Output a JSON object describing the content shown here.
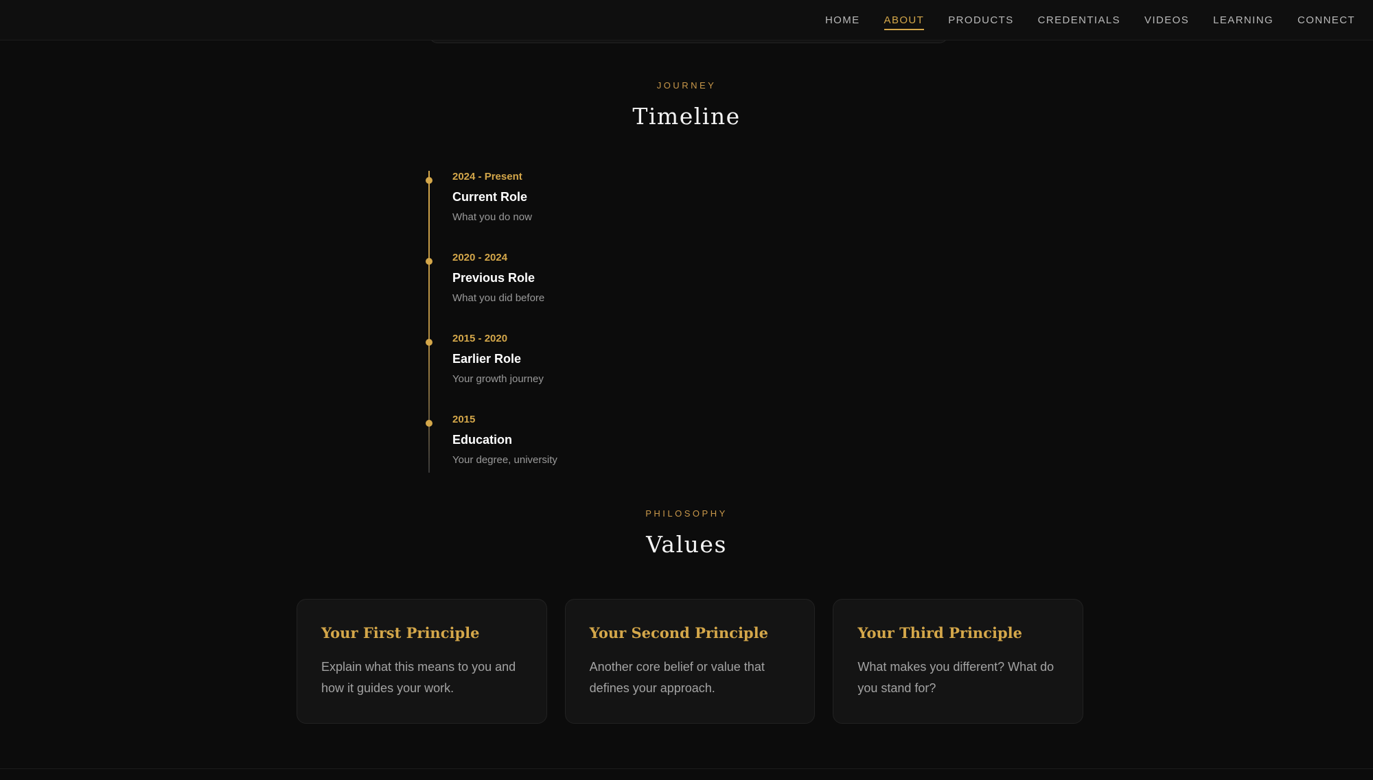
{
  "nav": {
    "items": [
      {
        "label": "HOME",
        "active": false
      },
      {
        "label": "ABOUT",
        "active": true
      },
      {
        "label": "PRODUCTS",
        "active": false
      },
      {
        "label": "CREDENTIALS",
        "active": false
      },
      {
        "label": "VIDEOS",
        "active": false
      },
      {
        "label": "LEARNING",
        "active": false
      },
      {
        "label": "CONNECT",
        "active": false
      }
    ]
  },
  "timeline_section": {
    "eyebrow": "JOURNEY",
    "title": "Timeline",
    "items": [
      {
        "date": "2024 - Present",
        "role": "Current Role",
        "description": "What you do now"
      },
      {
        "date": "2020 - 2024",
        "role": "Previous Role",
        "description": "What you did before"
      },
      {
        "date": "2015 - 2020",
        "role": "Earlier Role",
        "description": "Your growth journey"
      },
      {
        "date": "2015",
        "role": "Education",
        "description": "Your degree, university"
      }
    ]
  },
  "values_section": {
    "eyebrow": "PHILOSOPHY",
    "title": "Values",
    "cards": [
      {
        "title": "Your First Principle",
        "text": "Explain what this means to you and how it guides your work."
      },
      {
        "title": "Your Second Principle",
        "text": "Another core belief or value that defines your approach."
      },
      {
        "title": "Your Third Principle",
        "text": "What makes you different? What do you stand for?"
      }
    ]
  },
  "colors": {
    "background": "#0c0c0c",
    "accent": "#d4a74a",
    "card_background": "#141414",
    "muted_text": "#9a9a9a"
  }
}
